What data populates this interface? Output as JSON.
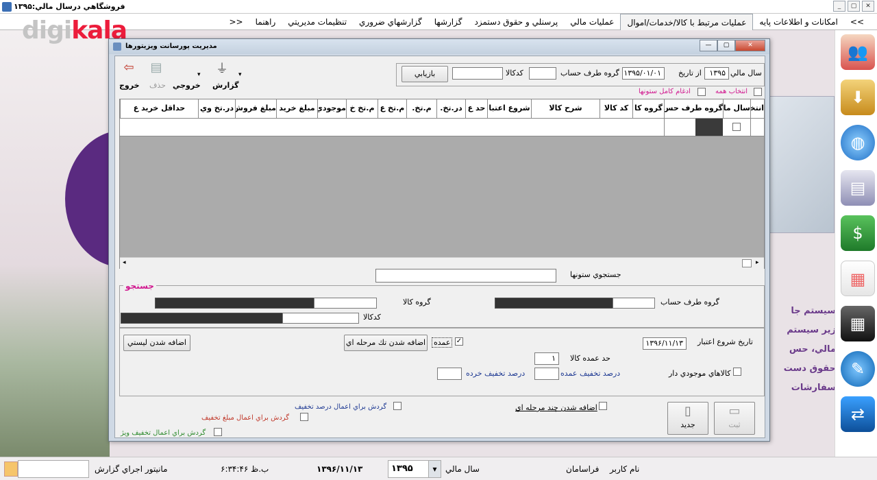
{
  "app": {
    "title": "فروشگاهي درسال مالي:۱۳۹۵"
  },
  "brand": {
    "prefix": "digi",
    "suffix": "kala"
  },
  "window_buttons": [
    "_",
    "▢",
    "✕"
  ],
  "menu": {
    "items": [
      "<<",
      "امکانات و اطلاعات پايه",
      "عمليات مرتبط با كالا/خدمات/اموال",
      "عمليات مالي",
      "پرسنلي و حقوق دستمزد",
      "گزارشها",
      "گزارشهاي ضروري",
      "تنظيمات مديريتي",
      "راهنما",
      ">>"
    ],
    "active_index": 2
  },
  "dialog": {
    "title": "مديريت پورسانت ويزيتورها",
    "buttons": {
      "minimize": "—",
      "maximize": "▢",
      "close": "✕"
    },
    "toolbar": {
      "exit": "خروج",
      "delete": "حذف",
      "output": "خروجي",
      "report": "گزارش"
    },
    "filter": {
      "year_label": "سال مالي",
      "year_value": "۱۳۹۵",
      "from_date_label": "از تاريخ",
      "from_date_value": "۱۳۹۵/۰۱/۰۱",
      "account_group_label": "گروه طرف حساب",
      "account_group_value": "",
      "code_label": "كدكالا",
      "code_value": "",
      "retrieve_button": "بازيابي",
      "select_all": "انتخاب همه",
      "merge_columns": "ادغام كامل ستونها"
    },
    "grid": {
      "columns": [
        "انتخاب",
        "سال ما",
        "گروه طرف حس",
        "گروه كا",
        "كد كالا",
        "شرح كالا",
        "شروع اعتبا",
        "حد ع",
        "در.تخ.",
        "م.تخ.",
        "م.تخ ع",
        "م.تخ خ",
        "موجودي",
        "مبلغ خريد",
        "مبلغ فروش",
        "در.تخ وي",
        "حداقل خريد ع"
      ]
    },
    "column_search": {
      "label": "جستجوي ستونها",
      "value": ""
    },
    "search": {
      "title": "جستجو",
      "account_group_label": "گروه طرف حساب",
      "item_group_label": "گروه كالا",
      "item_code_label": "كدكالا"
    },
    "settings": {
      "start_date_label": "تاريخ شروع اعتبار",
      "start_date_value": "۱۳۹۶/۱۱/۱۳",
      "wholesale_label": "عمده",
      "wholesale_checked": true,
      "add_single_stage_button": "اضافه شدن تك مرحله اي",
      "add_list_button": "اضافه شدن ليستي",
      "wholesale_limit_label": "حد عمده كالا",
      "wholesale_limit_value": "۱",
      "in_stock_label": "كالاهاي موجودي دار",
      "wholesale_discount_label": "درصد تخفيف عمده",
      "wholesale_discount_value": "",
      "retail_discount_label": "درصد تخفيف خرده",
      "retail_discount_value": ""
    },
    "options": {
      "multi_stage": "اضافه شدن چند مرحله اي",
      "rotate_discount_percent": "گردش براي اعمال درصد تخفيف",
      "rotate_discount_amount": "گردش براي اعمال مبلغ تخفيف",
      "rotate_special_discount": "گردش براي اعمال تخفيف ويژ"
    },
    "actions": {
      "new": "جديد",
      "save": "ثبت"
    }
  },
  "desktop_text": {
    "lines": [
      "سيستم جا",
      "زير سيستم",
      "مالي، حس",
      "حقوق دست",
      "سفارشات"
    ]
  },
  "statusbar": {
    "user_label": "نام كاربر",
    "user_value": "فراسامان",
    "year_label": "سال مالي",
    "year_value": "۱۳۹۵",
    "date": "۱۳۹۶/۱۱/۱۳",
    "time": "۶:۳۴:۴۶ ب.ظ",
    "report_label": "مانيتور اجراي گزارش"
  },
  "colors": {
    "accent_magenta": "#d1188f",
    "brand_red": "#ec1c3b",
    "dialog_frame": "#cfd9e5"
  }
}
